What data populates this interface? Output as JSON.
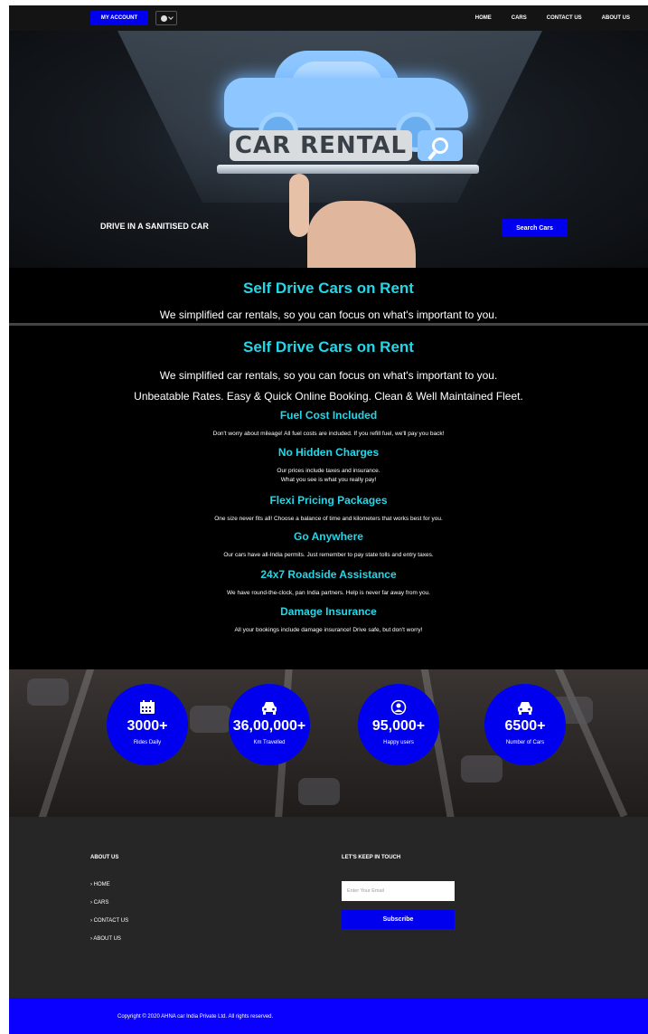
{
  "navbar": {
    "account_label": "MY ACCOUNT",
    "links": [
      "HOME",
      "CARS",
      "CONTACT US",
      "ABOUT US"
    ]
  },
  "hero": {
    "banner_text": "CAR RENTAL",
    "tagline": "DRIVE IN A SANITISED CAR",
    "search_label": "Search Cars"
  },
  "strip": {
    "title": "Self Drive Cars on Rent",
    "subtitle": "We simplified car rentals, so you can focus on what's important to you."
  },
  "features": {
    "title": "Self Drive Cars on Rent",
    "subtitle1": "We simplified car rentals, so you can focus on what's important to you.",
    "subtitle2": "Unbeatable Rates. Easy & Quick Online Booking. Clean & Well Maintained Fleet.",
    "items": [
      {
        "heading": "Fuel Cost Included",
        "lines": [
          "Don't worry about mileage! All fuel costs are included. If you refill fuel, we'll pay you back!"
        ]
      },
      {
        "heading": "No Hidden Charges",
        "lines": [
          "Our prices include taxes and insurance.",
          "What you see is what you really pay!"
        ]
      },
      {
        "heading": "Flexi Pricing Packages",
        "lines": [
          "One size never fits all! Choose a balance of time and kilometers that works best for you."
        ]
      },
      {
        "heading": "Go Anywhere",
        "lines": [
          "Our cars have all-India permits. Just remember to pay state tolls and entry taxes."
        ]
      },
      {
        "heading": "24x7 Roadside Assistance",
        "lines": [
          "We have round-the-clock, pan India partners. Help is never far away from you."
        ]
      },
      {
        "heading": "Damage Insurance",
        "lines": [
          "All your bookings include damage insurance! Drive safe, but don't worry!"
        ]
      }
    ]
  },
  "stats": [
    {
      "value": "3000+",
      "label": "Rides Daily",
      "icon": "calendar-icon"
    },
    {
      "value": "36,00,000+",
      "label": "Km Travelled",
      "icon": "car-icon"
    },
    {
      "value": "95,000+",
      "label": "Happy users",
      "icon": "user-icon"
    },
    {
      "value": "6500+",
      "label": "Number of Cars",
      "icon": "car-icon"
    }
  ],
  "footer": {
    "about_heading": "ABOUT US",
    "links": [
      "HOME",
      "CARS",
      "CONTACT US",
      "ABOUT US"
    ],
    "touch_heading": "LET'S KEEP IN TOUCH",
    "email_placeholder": "Enter Your Email",
    "subscribe_label": "Subscribe"
  },
  "copyright": "Copyright © 2020 AHNA car India Private Ltd. All rights reserved.",
  "colors": {
    "accent": "#0000ee",
    "cyan": "#23d7e8",
    "dark": "#000000",
    "footer": "#262626"
  }
}
